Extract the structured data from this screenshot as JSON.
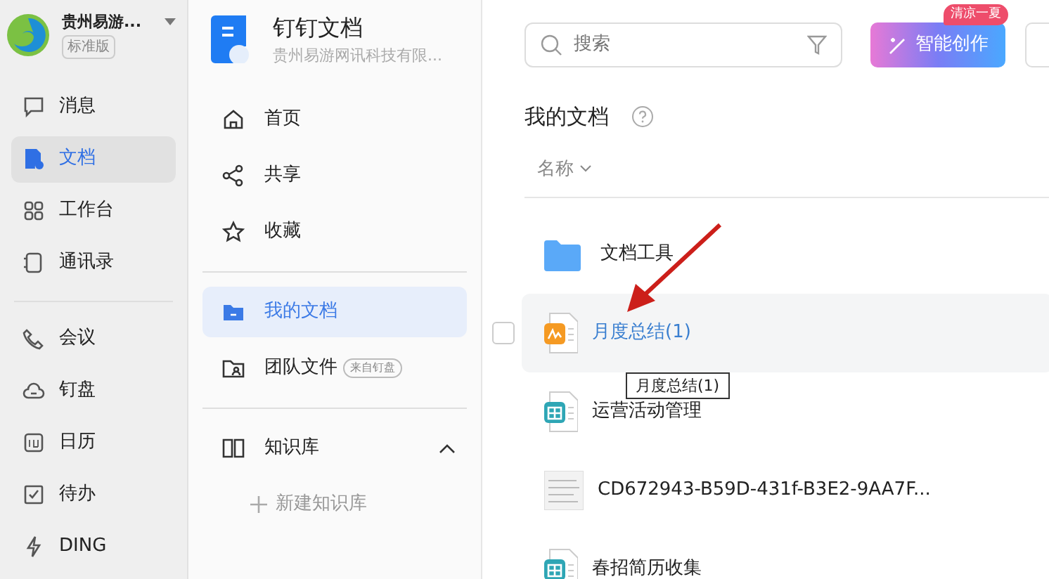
{
  "org": {
    "name": "贵州易游...",
    "edition": "标准版"
  },
  "nav_primary": [
    {
      "label": "消息",
      "selected": false
    },
    {
      "label": "文档",
      "selected": true
    },
    {
      "label": "工作台",
      "selected": false
    },
    {
      "label": "通讯录",
      "selected": false
    }
  ],
  "nav_secondary": [
    {
      "label": "会议",
      "selected": false
    },
    {
      "label": "钉盘",
      "selected": false
    },
    {
      "label": "日历",
      "selected": false
    },
    {
      "label": "待办",
      "selected": false
    },
    {
      "label": "DING",
      "selected": false
    }
  ],
  "app": {
    "title": "钉钉文档",
    "subtitle": "贵州易游网讯科技有限..."
  },
  "doc_nav": [
    {
      "label": "首页",
      "selected": false
    },
    {
      "label": "共享",
      "selected": false
    },
    {
      "label": "收藏",
      "selected": false
    },
    {
      "label": "我的文档",
      "selected": true
    },
    {
      "label": "团队文件",
      "tag": "来自钉盘",
      "selected": false
    }
  ],
  "knowledge": {
    "label": "知识库",
    "expanded": true,
    "new_label": "新建知识库"
  },
  "search": {
    "placeholder": "搜索"
  },
  "create_button": {
    "label": "智能创作",
    "badge": "清凉一夏"
  },
  "page_title": "我的文档",
  "sort": {
    "label": "名称"
  },
  "files": [
    {
      "kind": "folder",
      "name": "文档工具",
      "hovered": false
    },
    {
      "kind": "whiteboard",
      "name": "月度总结(1)",
      "hovered": true,
      "checked": false,
      "tooltip": "月度总结(1)"
    },
    {
      "kind": "sheet",
      "name": "运营活动管理",
      "hovered": false
    },
    {
      "kind": "image",
      "name": "CD672943-B59D-431f-B3E2-9AA7F...",
      "hovered": false
    },
    {
      "kind": "sheet",
      "name": "春招简历收集",
      "hovered": false
    }
  ]
}
